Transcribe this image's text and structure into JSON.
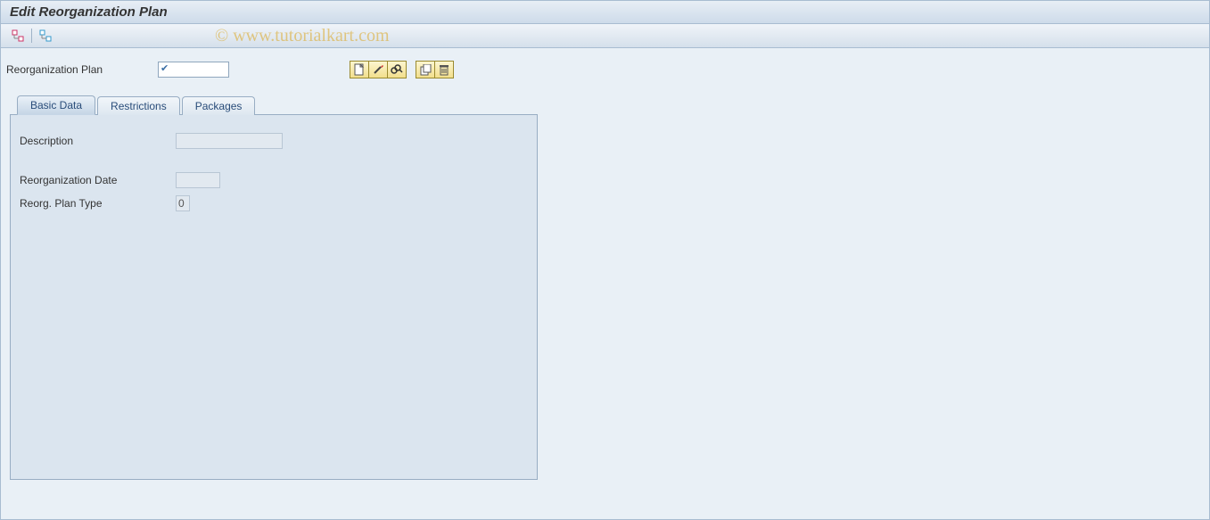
{
  "title": "Edit Reorganization Plan",
  "watermark": "© www.tutorialkart.com",
  "header_form": {
    "plan_label": "Reorganization Plan",
    "plan_value": ""
  },
  "action_icons": [
    "create",
    "change",
    "display",
    "copy",
    "delete"
  ],
  "tabs": [
    {
      "id": "basic",
      "label": "Basic Data",
      "active": true
    },
    {
      "id": "restrictions",
      "label": "Restrictions",
      "active": false
    },
    {
      "id": "packages",
      "label": "Packages",
      "active": false
    }
  ],
  "basic_data": {
    "description_label": "Description",
    "description_value": "",
    "date_label": "Reorganization Date",
    "date_value": "",
    "type_label": "Reorg. Plan Type",
    "type_value": "0"
  }
}
